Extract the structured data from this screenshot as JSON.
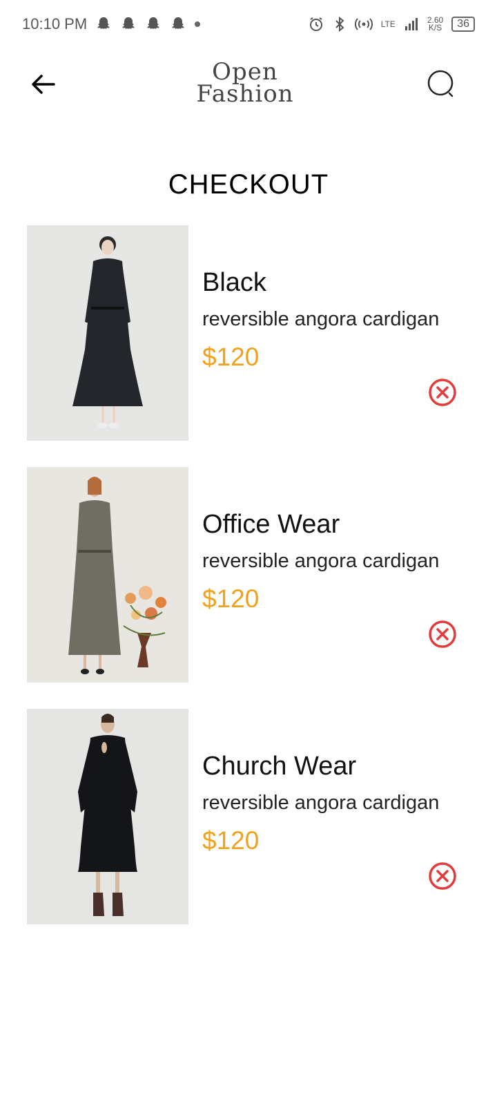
{
  "status_bar": {
    "time": "10:10 PM",
    "network": "LTE",
    "speed_value": "2.60",
    "speed_unit": "K/S",
    "battery": "36"
  },
  "header": {
    "logo_line1": "Open",
    "logo_line2": "Fashion",
    "icons": [
      "back-arrow-icon",
      "search-icon"
    ]
  },
  "page": {
    "title": "CHECKOUT"
  },
  "colors": {
    "price": "#F0A21E",
    "remove": "#E23B3B"
  },
  "items": [
    {
      "name": "Black",
      "description": "reversible angora cardigan",
      "price": "$120"
    },
    {
      "name": "Office Wear",
      "description": "reversible angora cardigan",
      "price": "$120"
    },
    {
      "name": "Church Wear",
      "description": "reversible angora cardigan",
      "price": "$120"
    }
  ]
}
